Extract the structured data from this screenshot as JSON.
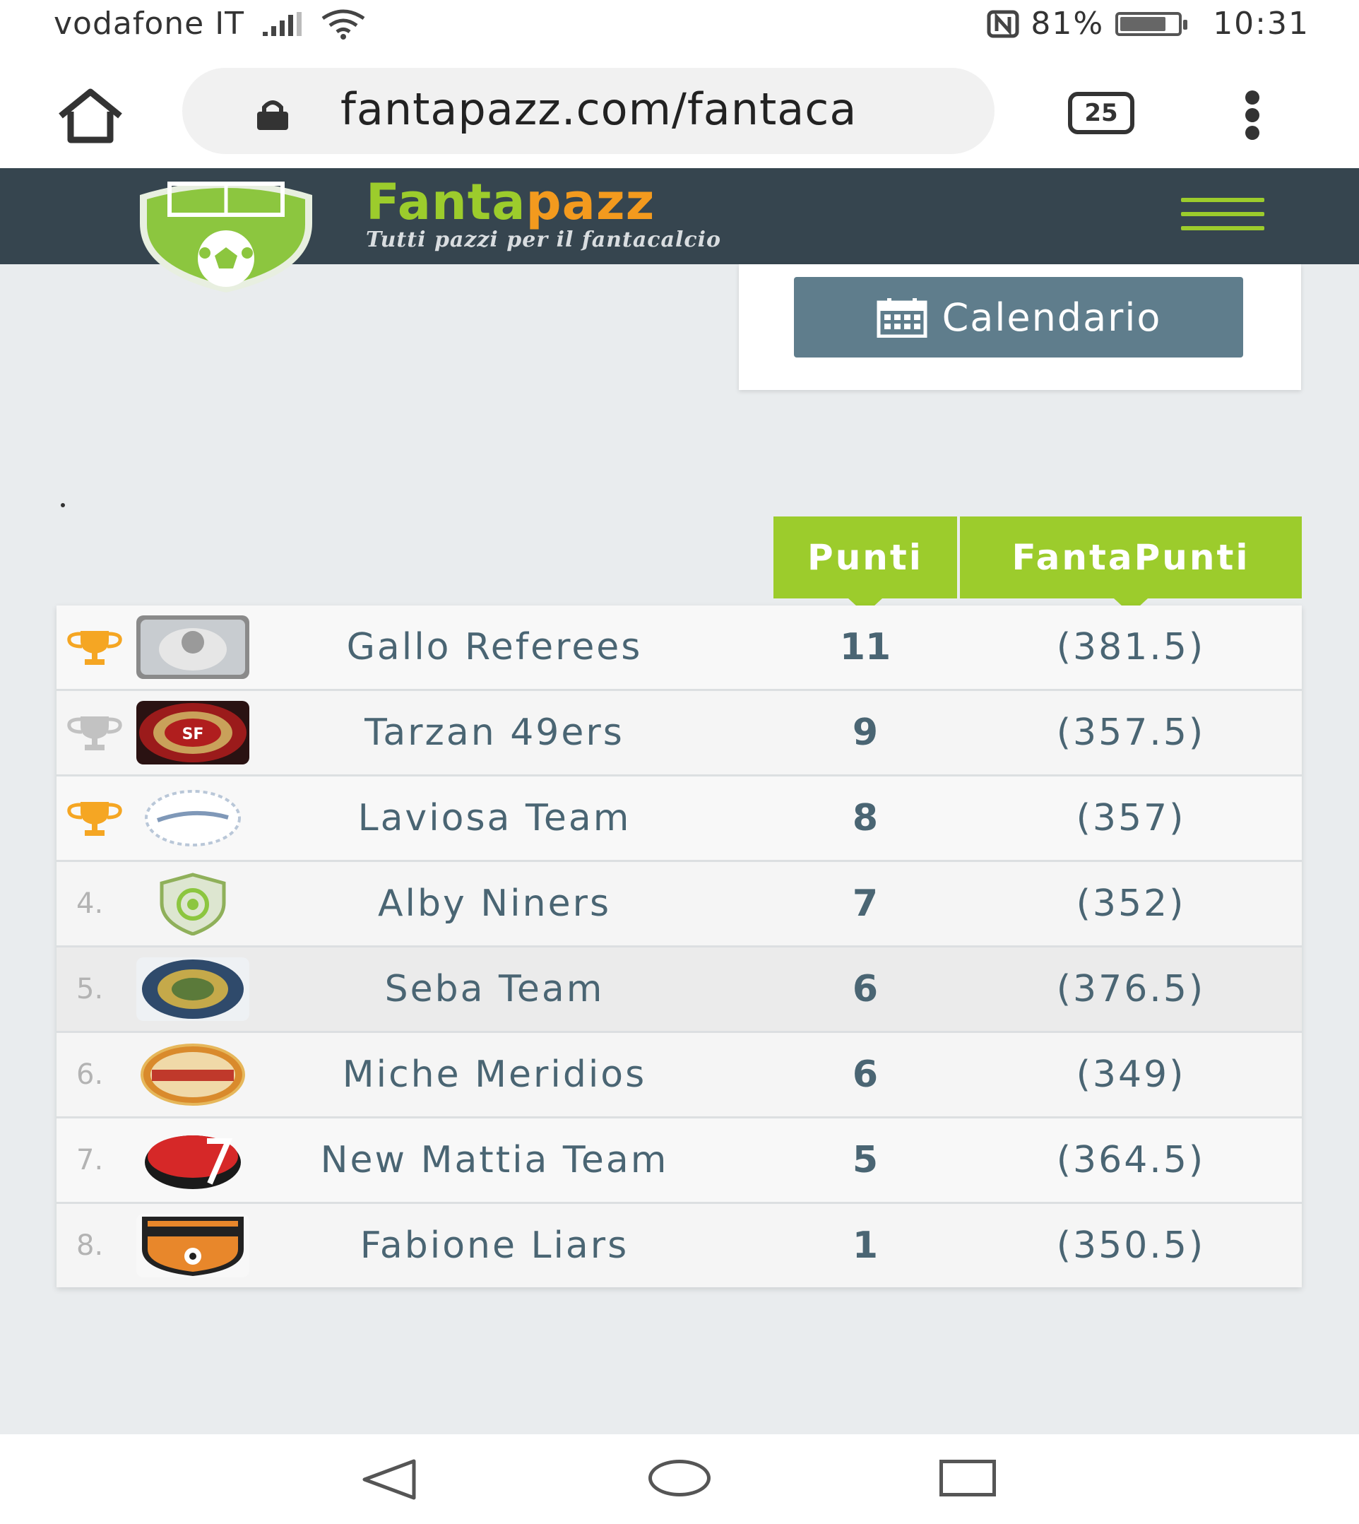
{
  "status_bar": {
    "carrier": "vodafone IT",
    "battery_percent": "81%",
    "time": "10:31"
  },
  "browser": {
    "url": "fantapazz.com/fantaca",
    "tab_count": "25"
  },
  "site": {
    "brand_part1": "Fanta",
    "brand_part2": "pazz",
    "tagline": "Tutti pazzi per il fantacalcio",
    "brand_color_green": "#9ccc2c",
    "brand_color_orange": "#f39a1e",
    "header_color": "#36454f"
  },
  "calendar_button": {
    "label": "Calendario"
  },
  "table": {
    "headers": {
      "punti": "Punti",
      "fantapunti": "FantaPunti"
    },
    "rows": [
      {
        "rank": "",
        "trophy": "gold",
        "team": "Gallo Referees",
        "punti": "11",
        "fantapunti": "(381.5)"
      },
      {
        "rank": "",
        "trophy": "silver",
        "team": "Tarzan 49ers",
        "punti": "9",
        "fantapunti": "(357.5)"
      },
      {
        "rank": "",
        "trophy": "gold",
        "team": "Laviosa Team",
        "punti": "8",
        "fantapunti": "(357)"
      },
      {
        "rank": "4.",
        "trophy": "",
        "team": "Alby Niners",
        "punti": "7",
        "fantapunti": "(352)"
      },
      {
        "rank": "5.",
        "trophy": "",
        "team": "Seba Team",
        "punti": "6",
        "fantapunti": "(376.5)"
      },
      {
        "rank": "6.",
        "trophy": "",
        "team": "Miche Meridios",
        "punti": "6",
        "fantapunti": "(349)"
      },
      {
        "rank": "7.",
        "trophy": "",
        "team": "New Mattia Team",
        "punti": "5",
        "fantapunti": "(364.5)"
      },
      {
        "rank": "8.",
        "trophy": "",
        "team": "Fabione Liars",
        "punti": "1",
        "fantapunti": "(350.5)"
      }
    ]
  }
}
